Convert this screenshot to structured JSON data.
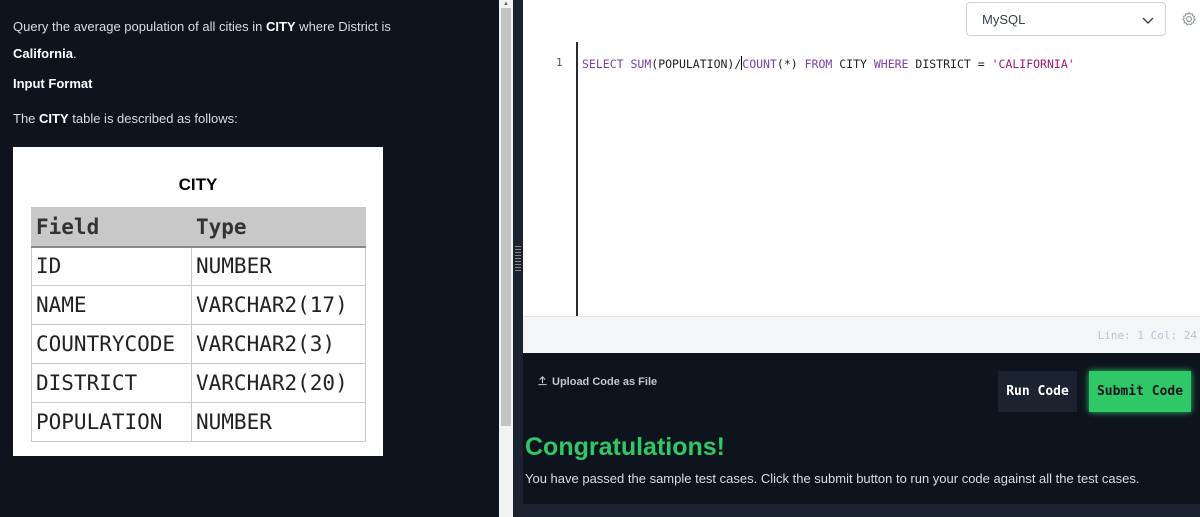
{
  "problem": {
    "intro_prefix": "Query the average population of all cities in ",
    "intro_bold": "CITY",
    "intro_suffix": " where District is",
    "intro_value": "California",
    "intro_end": ".",
    "input_format_heading": "Input Format",
    "described_prefix": "The ",
    "described_bold": "CITY",
    "described_suffix": " table is described as follows:"
  },
  "table": {
    "title": "CITY",
    "headers": [
      "Field",
      "Type"
    ],
    "rows": [
      [
        "ID",
        "NUMBER"
      ],
      [
        "NAME",
        "VARCHAR2(17)"
      ],
      [
        "COUNTRYCODE",
        "VARCHAR2(3)"
      ],
      [
        "DISTRICT",
        "VARCHAR2(20)"
      ],
      [
        "POPULATION",
        "NUMBER"
      ]
    ]
  },
  "editor": {
    "language": "MySQL",
    "line_number": "1",
    "code": {
      "t1": "SELECT",
      "t2": " ",
      "t3": "SUM",
      "t4": "(POPULATION)/",
      "t5": "COUNT",
      "t6": "(*) ",
      "t7": "FROM",
      "t8": " CITY ",
      "t9": "WHERE",
      "t10": " DISTRICT = ",
      "t11": "'CALIFORNIA'"
    },
    "status": "Line: 1 Col: 24"
  },
  "actions": {
    "upload_label": "Upload Code as File",
    "run_label": "Run Code",
    "submit_label": "Submit Code"
  },
  "result": {
    "title": "Congratulations!",
    "message": "You have passed the sample test cases. Click the submit button to run your code against all the test cases."
  },
  "colors": {
    "background": "#0e141e",
    "accent_green": "#2ec866",
    "editor_bg": "#ffffff"
  },
  "icons": [
    "chevron-down-icon",
    "gear-icon",
    "upload-icon"
  ]
}
